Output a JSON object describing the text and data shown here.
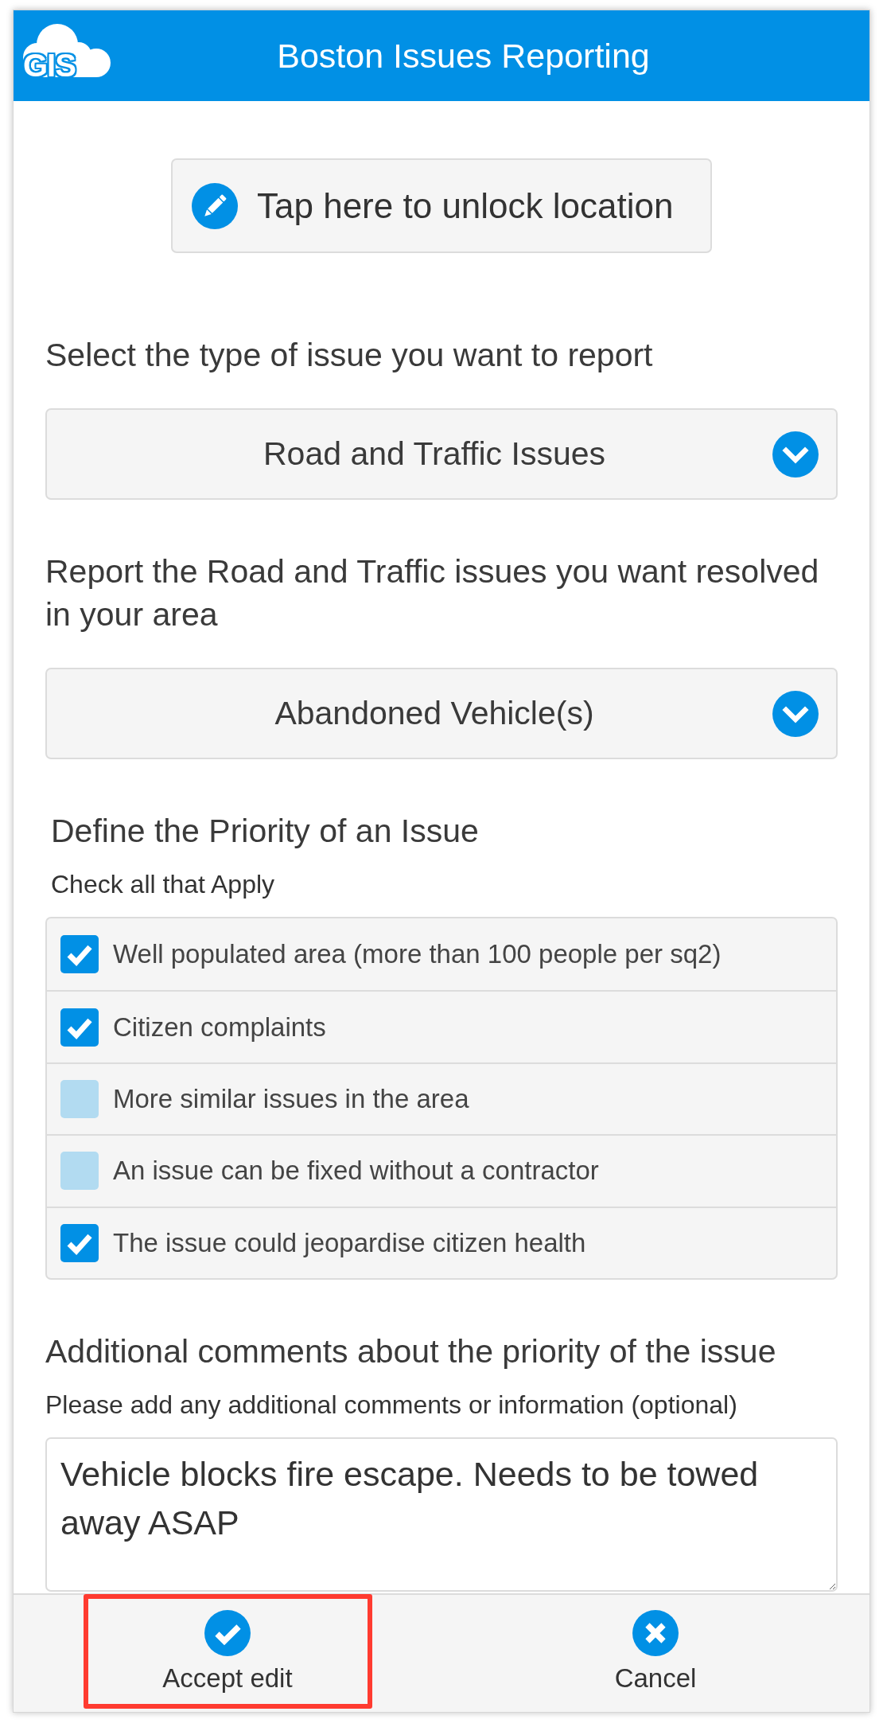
{
  "header": {
    "logo_text": "GIS",
    "title": "Boston Issues Reporting"
  },
  "location_button": {
    "label": "Tap here to unlock location"
  },
  "fields": [
    {
      "kind": "dropdown",
      "label": "Select the type of issue you want to report",
      "value": "Road and Traffic Issues"
    },
    {
      "kind": "dropdown",
      "label": "Report the Road and Traffic issues you want resolved in your area",
      "value": "Abandoned Vehicle(s)"
    },
    {
      "kind": "checklist",
      "label": "Define the Priority of an Issue",
      "hint": "Check all that Apply",
      "options": [
        {
          "label": "Well populated area (more than 100 people per sq2)",
          "checked": true
        },
        {
          "label": "Citizen complaints",
          "checked": true
        },
        {
          "label": "More similar issues in the area",
          "checked": false
        },
        {
          "label": "An issue can be fixed without a contractor",
          "checked": false
        },
        {
          "label": "The issue could jeopardise citizen health",
          "checked": true
        }
      ]
    },
    {
      "kind": "textarea",
      "label": "Additional comments about the priority of the issue",
      "hint": "Please add any additional comments or information (optional)",
      "value": "Vehicle blocks fire escape. Needs to be towed away ASAP"
    }
  ],
  "footer": {
    "buttons": [
      {
        "kind": "accept",
        "label": "Accept edit",
        "highlighted": true
      },
      {
        "kind": "cancel",
        "label": "Cancel",
        "highlighted": false
      }
    ]
  }
}
